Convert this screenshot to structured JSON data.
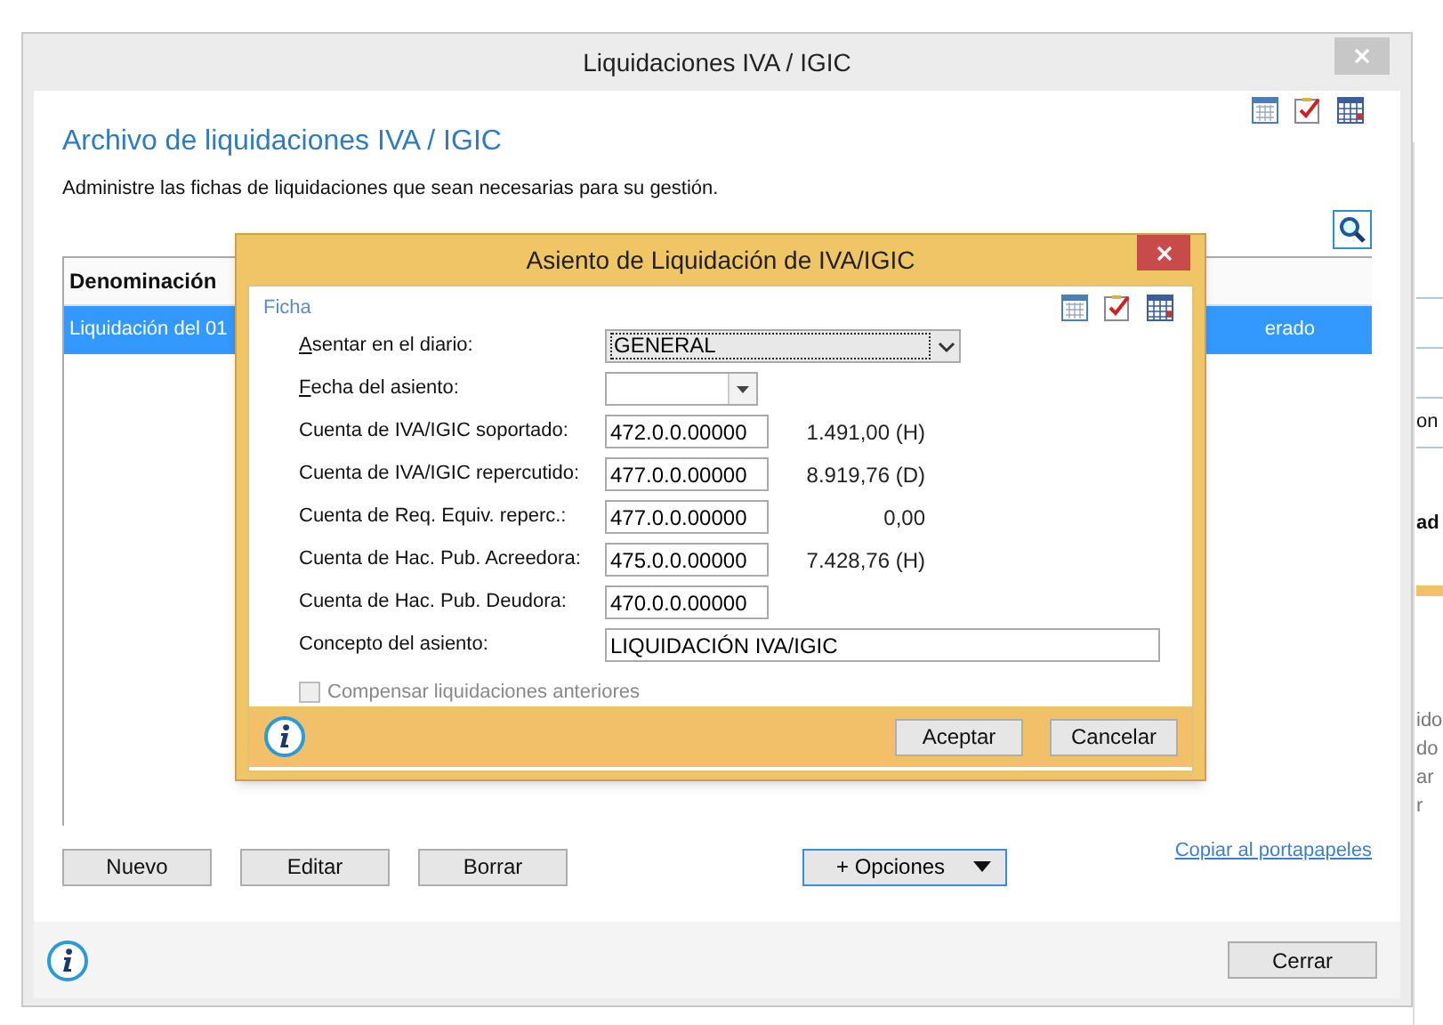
{
  "window": {
    "title": "Liquidaciones IVA / IGIC",
    "heading": "Archivo de liquidaciones IVA / IGIC",
    "description": "Administre las fichas de liquidaciones que sean necesarias para su gestión."
  },
  "table": {
    "columns": [
      "Denominación"
    ],
    "rows": [
      {
        "cells": [
          "Liquidación del 01",
          "erado"
        ],
        "selected": true
      }
    ]
  },
  "buttons": [
    "Nuevo",
    "Editar",
    "Borrar"
  ],
  "options_button": "+ Opciones",
  "copy_link": "Copiar al portapapeles",
  "close_button": "Cerrar",
  "background_window": {
    "texts": [
      "on",
      "ad",
      "ido",
      "do",
      "ar",
      "r"
    ]
  },
  "dialog": {
    "title": "Asiento de Liquidación de IVA/IGIC",
    "section": "Ficha",
    "rows": [
      {
        "kind": "select",
        "label": "Asentar en el diario:",
        "value": "GENERAL",
        "mnemonic": true
      },
      {
        "kind": "date",
        "label": "Fecha del asiento:",
        "mnemonic": true
      },
      {
        "kind": "account",
        "label": "Cuenta de IVA/IGIC soportado:",
        "value": "472.0.0.00000",
        "amount": "1.491,00 (H)"
      },
      {
        "kind": "account",
        "label": "Cuenta de IVA/IGIC repercutido:",
        "value": "477.0.0.00000",
        "amount": "8.919,76 (D)"
      },
      {
        "kind": "account",
        "label": "Cuenta de Req. Equiv.  reperc.:",
        "value": "477.0.0.00000",
        "amount": "0,00"
      },
      {
        "kind": "account",
        "label": "Cuenta de Hac. Pub. Acreedora:",
        "value": "475.0.0.00000",
        "amount": "7.428,76 (H)"
      },
      {
        "kind": "account",
        "label": "Cuenta de Hac. Pub. Deudora:",
        "value": "470.0.0.00000"
      },
      {
        "kind": "text",
        "label": "Concepto del asiento:",
        "value": "LIQUIDACIÓN IVA/IGIC"
      }
    ],
    "checkbox": {
      "label": "Compensar liquidaciones anteriores",
      "checked": false,
      "disabled": true
    },
    "buttons": [
      "Aceptar",
      "Cancelar"
    ]
  }
}
